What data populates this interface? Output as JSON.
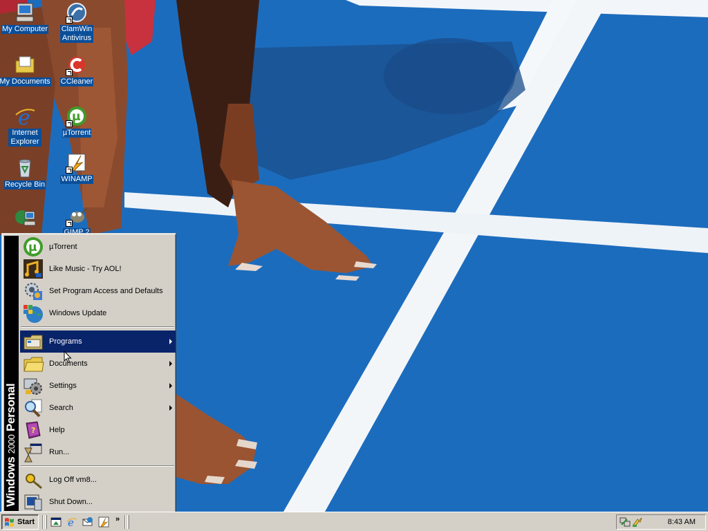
{
  "desktop": {
    "icons": [
      {
        "label": "My Computer",
        "icon": "my-computer-icon"
      },
      {
        "label": "ClamWin Antivirus",
        "icon": "clamwin-icon"
      },
      {
        "label": "My Documents",
        "icon": "my-documents-icon"
      },
      {
        "label": "CCleaner",
        "icon": "ccleaner-icon"
      },
      {
        "label": "Internet Explorer",
        "icon": "internet-explorer-icon"
      },
      {
        "label": "µTorrent",
        "icon": "utorrent-icon"
      },
      {
        "label": "Recycle Bin",
        "icon": "recycle-bin-icon"
      },
      {
        "label": "WINAMP",
        "icon": "winamp-icon"
      },
      {
        "label": "",
        "icon": "network-icon"
      },
      {
        "label": "GIMP 2",
        "icon": "gimp-icon"
      }
    ]
  },
  "start_menu": {
    "banner": {
      "brand": "Windows",
      "version": "2000",
      "edition": "Personal"
    },
    "pinned": [
      {
        "label": "µTorrent",
        "icon": "utorrent-icon"
      },
      {
        "label": "Like Music - Try AOL!",
        "icon": "aol-music-icon"
      },
      {
        "label": "Set Program Access and Defaults",
        "icon": "program-access-icon"
      },
      {
        "label": "Windows Update",
        "icon": "windows-update-icon"
      }
    ],
    "main": [
      {
        "label": "Programs",
        "icon": "programs-folder-icon",
        "submenu": true,
        "selected": true
      },
      {
        "label": "Documents",
        "icon": "documents-folder-icon",
        "submenu": true,
        "selected": false
      },
      {
        "label": "Settings",
        "icon": "settings-icon",
        "submenu": true,
        "selected": false
      },
      {
        "label": "Search",
        "icon": "search-icon",
        "submenu": true,
        "selected": false
      },
      {
        "label": "Help",
        "icon": "help-book-icon",
        "submenu": false,
        "selected": false
      },
      {
        "label": "Run...",
        "icon": "run-icon",
        "submenu": false,
        "selected": false
      }
    ],
    "session": [
      {
        "label": "Log Off vm8...",
        "icon": "log-off-icon"
      },
      {
        "label": "Shut Down...",
        "icon": "shut-down-icon"
      }
    ]
  },
  "taskbar": {
    "start_label": "Start",
    "quick_launch": [
      "show-desktop-icon",
      "internet-explorer-icon",
      "outlook-express-icon",
      "winamp-icon"
    ],
    "more_label": "»",
    "tray_icons": [
      "network-connection-icon",
      "power-icon"
    ],
    "clock": "8:43 AM"
  },
  "colors": {
    "menu_selected": "#0a246a",
    "face": "#d4d0c8",
    "desktop_label_bg": "#0a4f9a",
    "track_blue": "#1a6dbf"
  }
}
